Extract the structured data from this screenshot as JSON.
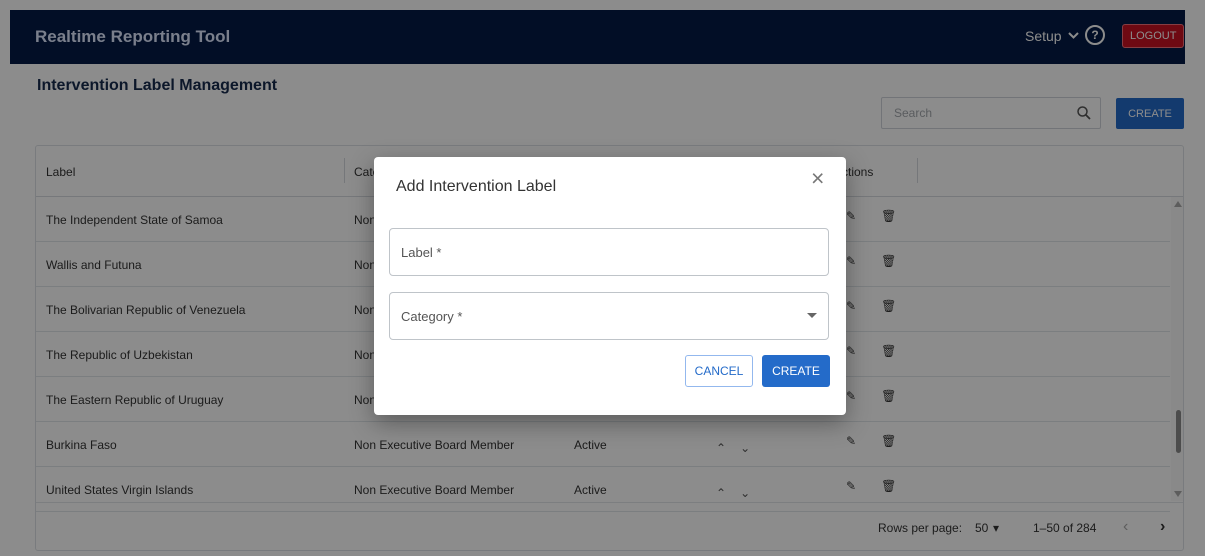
{
  "app": {
    "title": "Realtime Reporting Tool"
  },
  "nav": {
    "setup": "Setup",
    "logout": "LOGOUT"
  },
  "page": {
    "title": "Intervention Label Management"
  },
  "search": {
    "placeholder": "Search"
  },
  "toolbar": {
    "create": "CREATE"
  },
  "table": {
    "headers": [
      "Label",
      "Cate",
      "ctions"
    ],
    "rows": [
      {
        "label": "The Independent State of Samoa",
        "category": "Non"
      },
      {
        "label": "Wallis and Futuna",
        "category": "Non"
      },
      {
        "label": "The Bolivarian Republic of Venezuela",
        "category": "Non"
      },
      {
        "label": "The Republic of Uzbekistan",
        "category": "Non"
      },
      {
        "label": "The Eastern Republic of Uruguay",
        "category": "Non"
      },
      {
        "label": "Burkina Faso",
        "category": "Non Executive Board Member",
        "status": "Active"
      },
      {
        "label": "United States Virgin Islands",
        "category": "Non Executive Board Member",
        "status": "Active"
      }
    ]
  },
  "pagination": {
    "rows_label": "Rows per page:",
    "rows_value": "50",
    "range": "1–50 of 284"
  },
  "modal": {
    "title": "Add Intervention Label",
    "label_field": "Label *",
    "category_field": "Category *",
    "cancel": "CANCEL",
    "create": "CREATE"
  },
  "colors": {
    "navbar": "#051b45",
    "primary": "#246bc9",
    "logout": "#c81222"
  },
  "icons": {
    "search": "search-icon",
    "help": "help-icon",
    "edit": "pencil-icon",
    "delete": "trash-icon",
    "close": "close-icon"
  }
}
